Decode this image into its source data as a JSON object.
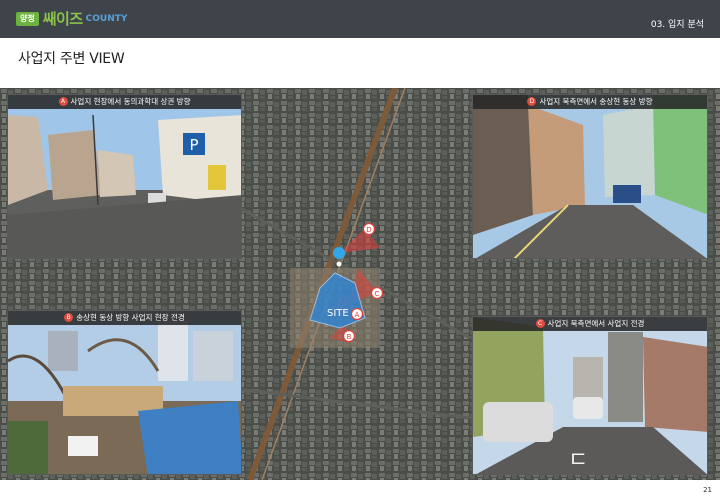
{
  "header": {
    "logo_badge": "양정",
    "logo_main": "쌔이즈",
    "logo_sub": "COUNTY",
    "section": "03. 입지 분석"
  },
  "title": "사업지 주변 VIEW",
  "map": {
    "site_label": "SITE",
    "markers": {
      "a": "A",
      "b": "B",
      "c": "C",
      "d": "D"
    }
  },
  "photos": [
    {
      "marker": "A",
      "caption": "사업지 현장에서 동의과학대 상권 방향"
    },
    {
      "marker": "D",
      "caption": "사업지 북측면에서 송상현 동상 방향"
    },
    {
      "marker": "B",
      "caption": "송상현 동상 방향 사업지 현장 전경"
    },
    {
      "marker": "C",
      "caption": "사업지 북측면에서 사업지 전경"
    }
  ],
  "photo_a": {
    "sign": "P"
  },
  "page_number": "21"
}
